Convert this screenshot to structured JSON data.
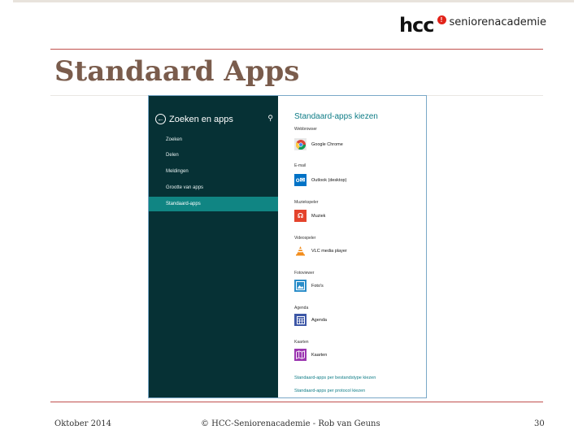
{
  "logo": {
    "hcc": "hcc",
    "sub": "seniorenacademie"
  },
  "title": "Standaard Apps",
  "sidebar": {
    "title": "Zoeken en apps",
    "items": [
      "Zoeken",
      "Delen",
      "Meldingen",
      "Grootte van apps",
      "Standaard-apps"
    ],
    "active": "Standaard-apps"
  },
  "main": {
    "title": "Standaard-apps kiezen",
    "sections": [
      {
        "category": "Webbrowser",
        "app": "Google Chrome",
        "icon": "chrome-icon",
        "color": "#e8e8e8"
      },
      {
        "category": "E-mail",
        "app": "Outlook (desktop)",
        "icon": "outlook-icon",
        "color": "#0072c6"
      },
      {
        "category": "Muziekspeler",
        "app": "Muziek",
        "icon": "music-icon",
        "color": "#e4432c"
      },
      {
        "category": "Videospeler",
        "app": "VLC media player",
        "icon": "vlc-icon",
        "color": "#ffffff"
      },
      {
        "category": "Fotoviewer",
        "app": "Foto's",
        "icon": "photos-icon",
        "color": "#2a8dc9"
      },
      {
        "category": "Agenda",
        "app": "Agenda",
        "icon": "calendar-icon",
        "color": "#3d57a6"
      },
      {
        "category": "Kaarten",
        "app": "Kaarten",
        "icon": "maps-icon",
        "color": "#9b35b0"
      }
    ],
    "links": [
      "Standaard-apps per bestandstype kiezen",
      "Standaard-apps per protocol kiezen"
    ]
  },
  "footer": {
    "date": "Oktober 2014",
    "credit": "© HCC-Seniorenacademie - Rob van Geuns",
    "page": "30"
  },
  "colors": {
    "accent": "#c0504d",
    "title": "#7a5c4c",
    "sidebar_bg": "#063135",
    "sidebar_active": "#108583",
    "link": "#0e7c86"
  }
}
